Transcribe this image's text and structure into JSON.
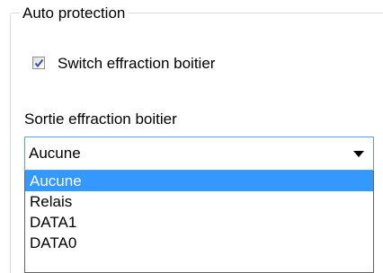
{
  "group": {
    "title": "Auto protection"
  },
  "checkbox": {
    "label": "Switch effraction boitier",
    "checked": true
  },
  "combo": {
    "label": "Sortie effraction boitier",
    "value": "Aucune",
    "options": [
      "Aucune",
      "Relais",
      "DATA1",
      "DATA0"
    ],
    "highlighted_index": 0
  },
  "colors": {
    "accent": "#3399ff",
    "combo_border": "#569de5",
    "group_border": "#d5dfe5"
  },
  "icons": {
    "checkmark": "checkmark-icon",
    "dropdown": "chevron-down-icon"
  }
}
